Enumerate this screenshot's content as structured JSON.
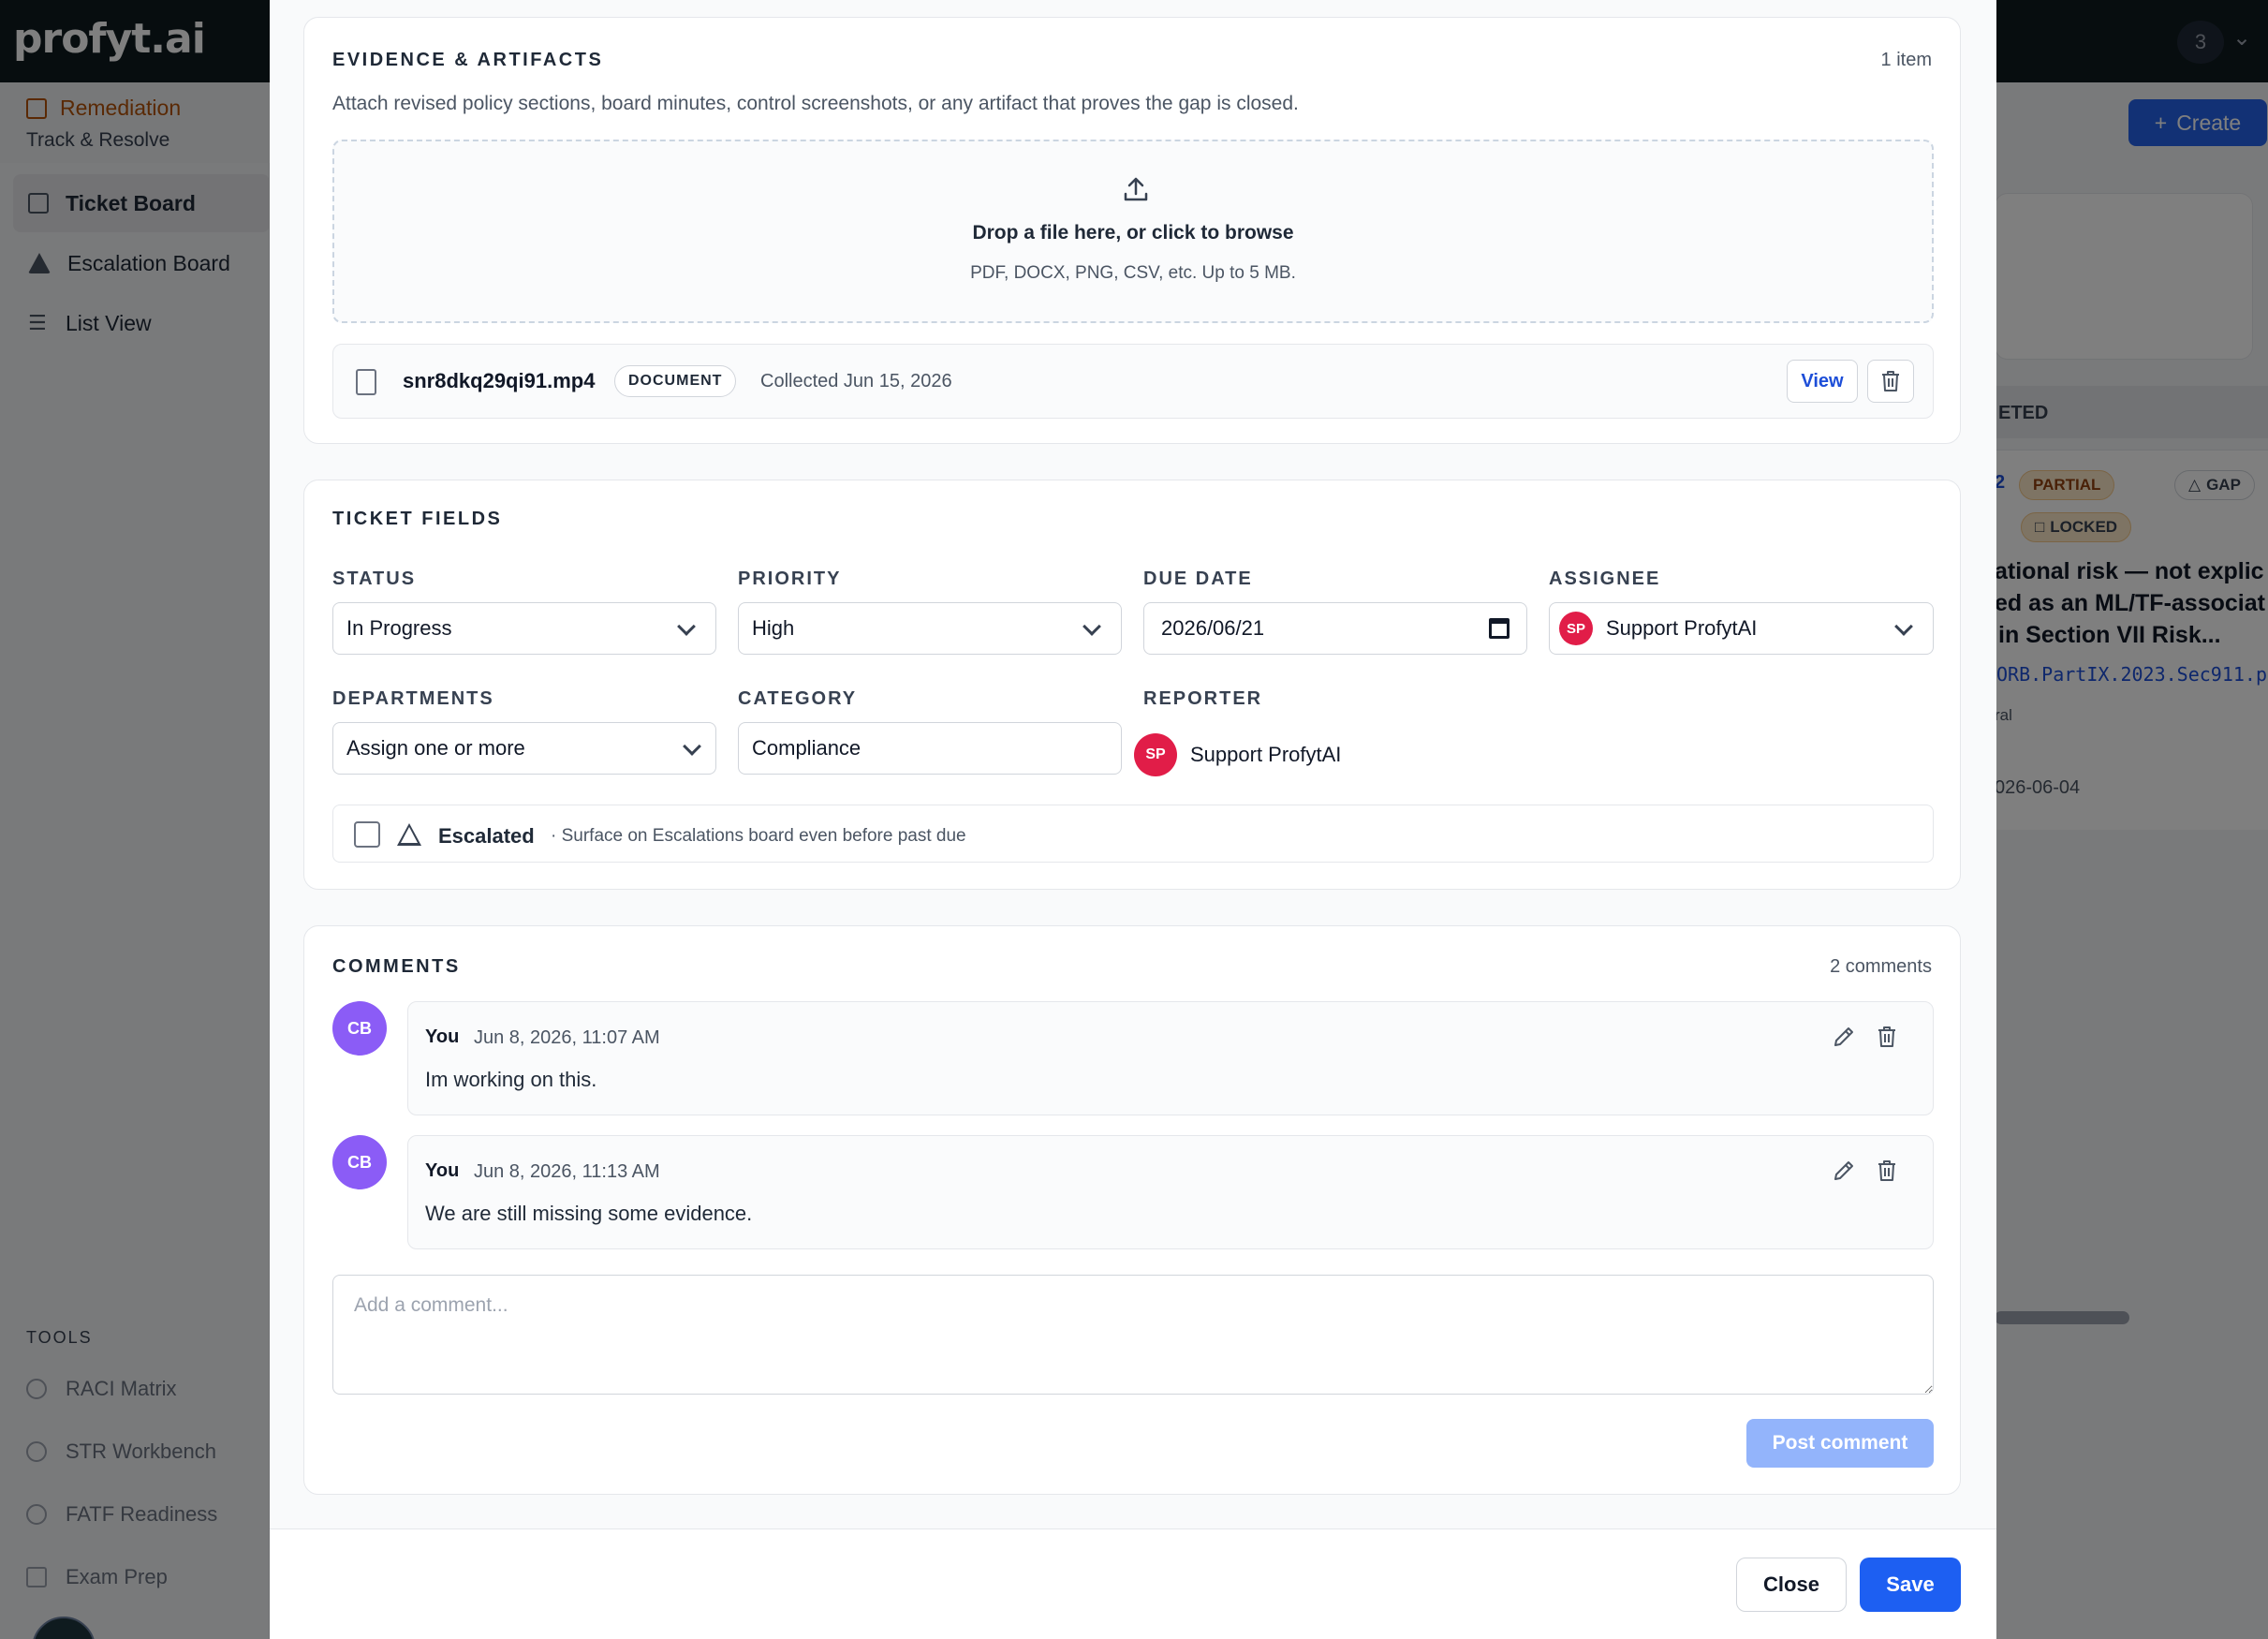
{
  "app": {
    "logo": "profyt.ai",
    "notification_count": "3"
  },
  "sidebar": {
    "section_title": "Remediation",
    "section_subtitle": "Track & Resolve",
    "items": [
      {
        "label": "Ticket Board",
        "icon": "grid-icon",
        "active": true
      },
      {
        "label": "Escalation Board",
        "icon": "warning-icon"
      },
      {
        "label": "List View",
        "icon": "list-icon"
      }
    ],
    "tools_title": "TOOLS",
    "tools": [
      {
        "label": "RACI Matrix"
      },
      {
        "label": "STR Workbench"
      },
      {
        "label": "FATF Readiness"
      },
      {
        "label": "Exam Prep"
      }
    ]
  },
  "background_board": {
    "create_label": "Create",
    "column_title": "ETED",
    "card": {
      "count": "2",
      "badge_partial": "PARTIAL",
      "badge_gap": "GAP",
      "badge_locked": "LOCKED",
      "title_lines": [
        "ational risk — not explic",
        "ed as an ML/TF-associat",
        "in Section VII Risk..."
      ],
      "reference": "ORB.PartIX.2023.Sec911.p",
      "tag": "ral",
      "date": "026-06-04"
    }
  },
  "modal": {
    "evidence": {
      "title": "EVIDENCE & ARTIFACTS",
      "count": "1 item",
      "description": "Attach revised policy sections, board minutes, control screenshots, or any artifact that proves the gap is closed.",
      "drop_title": "Drop a file here, or click to browse",
      "drop_subtitle": "PDF, DOCX, PNG, CSV, etc. Up to 5 MB.",
      "files": [
        {
          "name": "snr8dkq29qi91.mp4",
          "type": "DOCUMENT",
          "collected": "Collected Jun 15, 2026",
          "view_label": "View"
        }
      ]
    },
    "ticket_fields": {
      "title": "TICKET FIELDS",
      "status": {
        "label": "STATUS",
        "value": "In Progress"
      },
      "priority": {
        "label": "PRIORITY",
        "value": "High"
      },
      "due_date": {
        "label": "DUE DATE",
        "value": "2026/06/21"
      },
      "assignee": {
        "label": "ASSIGNEE",
        "value": "Support ProfytAI",
        "initials": "SP"
      },
      "departments": {
        "label": "DEPARTMENTS",
        "value": "Assign one or more"
      },
      "category": {
        "label": "CATEGORY",
        "value": "Compliance"
      },
      "reporter": {
        "label": "REPORTER",
        "value": "Support ProfytAI",
        "initials": "SP"
      },
      "escalated": {
        "label": "Escalated",
        "hint": "· Surface on Escalations board even before past due",
        "checked": false
      }
    },
    "comments": {
      "title": "COMMENTS",
      "count": "2 comments",
      "items": [
        {
          "initials": "CB",
          "author": "You",
          "time": "Jun 8, 2026, 11:07 AM",
          "text": "Im working on this."
        },
        {
          "initials": "CB",
          "author": "You",
          "time": "Jun 8, 2026, 11:13 AM",
          "text": "We are still missing some evidence."
        }
      ],
      "input_placeholder": "Add a comment...",
      "post_label": "Post comment"
    },
    "footer": {
      "close_label": "Close",
      "save_label": "Save"
    }
  },
  "colors": {
    "primary": "#1d5ff2",
    "avatar_assignee": "#e11d48",
    "avatar_commenter": "#8b5cf6",
    "remediation_accent": "#b45309"
  }
}
